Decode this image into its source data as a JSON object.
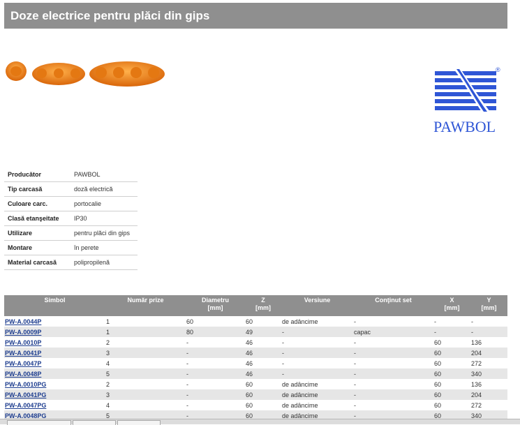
{
  "page": {
    "title": "Doze electrice pentru plăci din gips"
  },
  "logo": {
    "brand": "PAWBOL",
    "registered": "®"
  },
  "properties": [
    {
      "label": "Producător",
      "value": "PAWBOL"
    },
    {
      "label": "Tip carcasă",
      "value": "doză electrică"
    },
    {
      "label": "Culoare carc.",
      "value": "portocalie"
    },
    {
      "label": "Clasă etanşeitate",
      "value": "IP30"
    },
    {
      "label": "Utilizare",
      "value": "pentru plăci din gips"
    },
    {
      "label": "Montare",
      "value": "în perete"
    },
    {
      "label": "Material carcasă",
      "value": "polipropilenă"
    }
  ],
  "table": {
    "headers": {
      "simbol": "Simbol",
      "prize": "Număr prize",
      "diametru": "Diametru",
      "diametru_unit": "[mm]",
      "z": "Z",
      "z_unit": "[mm]",
      "versiune": "Versiune",
      "continut": "Conţinut set",
      "x": "X",
      "x_unit": "[mm]",
      "y": "Y",
      "y_unit": "[mm]"
    },
    "rows": [
      {
        "simbol": "PW-A.0044P",
        "prize": "1",
        "diametru": "60",
        "z": "60",
        "versiune": "de adâncime",
        "continut": "-",
        "x": "-",
        "y": "-"
      },
      {
        "simbol": "PW-A.0009P",
        "prize": "1",
        "diametru": "80",
        "z": "49",
        "versiune": "-",
        "continut": "capac",
        "x": "-",
        "y": "-"
      },
      {
        "simbol": "PW-A.0010P",
        "prize": "2",
        "diametru": "-",
        "z": "46",
        "versiune": "-",
        "continut": "-",
        "x": "60",
        "y": "136"
      },
      {
        "simbol": "PW-A.0041P",
        "prize": "3",
        "diametru": "-",
        "z": "46",
        "versiune": "-",
        "continut": "-",
        "x": "60",
        "y": "204"
      },
      {
        "simbol": "PW-A.0047P",
        "prize": "4",
        "diametru": "-",
        "z": "46",
        "versiune": "-",
        "continut": "-",
        "x": "60",
        "y": "272"
      },
      {
        "simbol": "PW-A.0048P",
        "prize": "5",
        "diametru": "-",
        "z": "46",
        "versiune": "-",
        "continut": "-",
        "x": "60",
        "y": "340"
      },
      {
        "simbol": "PW-A.0010PG",
        "prize": "2",
        "diametru": "-",
        "z": "60",
        "versiune": "de adâncime",
        "continut": "-",
        "x": "60",
        "y": "136"
      },
      {
        "simbol": "PW-A.0041PG",
        "prize": "3",
        "diametru": "-",
        "z": "60",
        "versiune": "de adâncime",
        "continut": "-",
        "x": "60",
        "y": "204"
      },
      {
        "simbol": "PW-A.0047PG",
        "prize": "4",
        "diametru": "-",
        "z": "60",
        "versiune": "de adâncime",
        "continut": "-",
        "x": "60",
        "y": "272"
      },
      {
        "simbol": "PW-A.0048PG",
        "prize": "5",
        "diametru": "-",
        "z": "60",
        "versiune": "de adâncime",
        "continut": "-",
        "x": "60",
        "y": "340"
      }
    ]
  },
  "colors": {
    "header_bg": "#8f8f8f",
    "link": "#1d3d8f",
    "logo_blue": "#2f56d6",
    "box_orange": "#f08a1c"
  }
}
